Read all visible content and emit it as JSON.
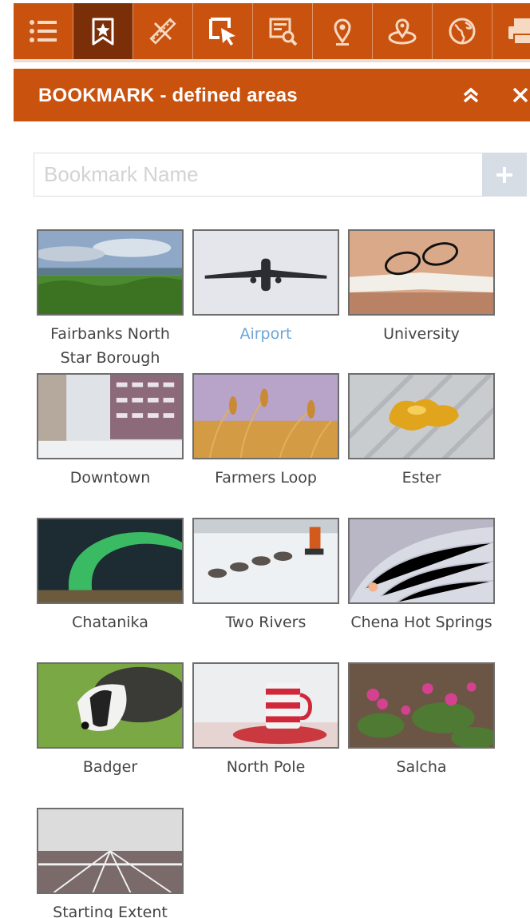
{
  "toolbar": {
    "tools": [
      {
        "icon": "list-icon"
      },
      {
        "icon": "bookmark-icon",
        "active": true
      },
      {
        "icon": "measure-icon"
      },
      {
        "icon": "select-icon"
      },
      {
        "icon": "query-icon"
      },
      {
        "icon": "locate-icon"
      },
      {
        "icon": "geocode-icon"
      },
      {
        "icon": "globe-icon"
      },
      {
        "icon": "print-icon"
      }
    ]
  },
  "panel": {
    "title": "BOOKMARK - defined areas"
  },
  "bookmark_input": {
    "placeholder": "Bookmark Name",
    "value": ""
  },
  "bookmarks": [
    {
      "label": "Fairbanks North Star Borough",
      "thumb": "landscape-thumbnail"
    },
    {
      "label": "Airport",
      "thumb": "airplane-thumbnail",
      "hovered": true
    },
    {
      "label": "University",
      "thumb": "book-glasses-thumbnail"
    },
    {
      "label": "Downtown",
      "thumb": "city-street-thumbnail"
    },
    {
      "label": "Farmers Loop",
      "thumb": "wheat-thumbnail"
    },
    {
      "label": "Ester",
      "thumb": "gold-nugget-thumbnail"
    },
    {
      "label": "Chatanika",
      "thumb": "aurora-thumbnail"
    },
    {
      "label": "Two Rivers",
      "thumb": "sled-dogs-thumbnail"
    },
    {
      "label": "Chena Hot Springs",
      "thumb": "ice-dome-thumbnail"
    },
    {
      "label": "Badger",
      "thumb": "badger-thumbnail"
    },
    {
      "label": "North Pole",
      "thumb": "candy-mug-thumbnail"
    },
    {
      "label": "Salcha",
      "thumb": "fireweed-thumbnail"
    },
    {
      "label": "Starting Extent",
      "thumb": "running-track-thumbnail"
    }
  ],
  "colors": {
    "brand": "#c9520f",
    "active_tool": "#7a2f08",
    "link": "#6ea5d8",
    "label": "#444444"
  }
}
